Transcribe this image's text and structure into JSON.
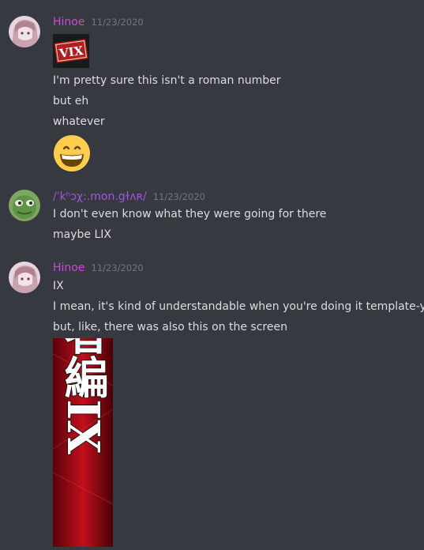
{
  "messages": [
    {
      "username": "Hinoe",
      "timestamp": "11/23/2020",
      "image_label": "VIX",
      "lines": [
        "I'm pretty sure this isn't a roman number",
        "but eh",
        "whatever"
      ],
      "emoji": "grinning-face"
    },
    {
      "username": "/ˈkʰɔχ:.mon.gɫʌʀ/",
      "timestamp": "11/23/2020",
      "lines": [
        "I don't even know what they were going for there",
        "maybe LIX"
      ]
    },
    {
      "username": "Hinoe",
      "timestamp": "11/23/2020",
      "lines": [
        "IX",
        "I mean, it's kind of understandable when you're doing it template-y",
        "but, like, there was also this on the screen"
      ],
      "image_text": "来訪者編IX"
    }
  ],
  "colors": {
    "background": "#36393f",
    "username_hinoe": "#c84bd4",
    "username_other": "#a354e0",
    "timestamp": "#72767d",
    "text": "#dcddde"
  }
}
